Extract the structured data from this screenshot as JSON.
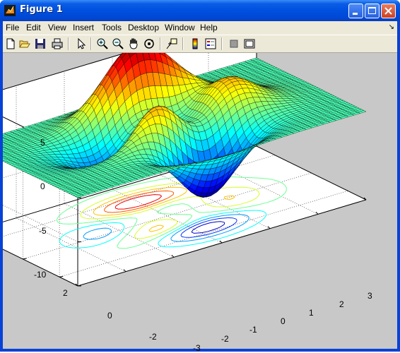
{
  "window": {
    "title": "Figure 1"
  },
  "menu": [
    "File",
    "Edit",
    "View",
    "Insert",
    "Tools",
    "Desktop",
    "Window",
    "Help"
  ],
  "menu_arrow": "↘",
  "toolbar_icons": [
    "new-figure-icon",
    "open-file-icon",
    "save-icon",
    "print-icon",
    "edit-plot-arrow-icon",
    "zoom-in-icon",
    "zoom-out-icon",
    "pan-hand-icon",
    "rotate-3d-icon",
    "data-cursor-icon",
    "insert-colorbar-icon",
    "insert-legend-icon",
    "hide-plot-tools-icon",
    "show-plot-tools-icon"
  ],
  "axes": {
    "z_ticks": [
      "5",
      "0",
      "-5",
      "-10"
    ],
    "y_ticks": [
      "2",
      "0",
      "-2"
    ],
    "x_ticks": [
      "-3",
      "-2",
      "-1",
      "0",
      "1",
      "2",
      "3"
    ]
  },
  "colors": {
    "title_bar": "#0054e3",
    "figure_bg": "#c8c8c8",
    "mesh": "#000000"
  }
}
